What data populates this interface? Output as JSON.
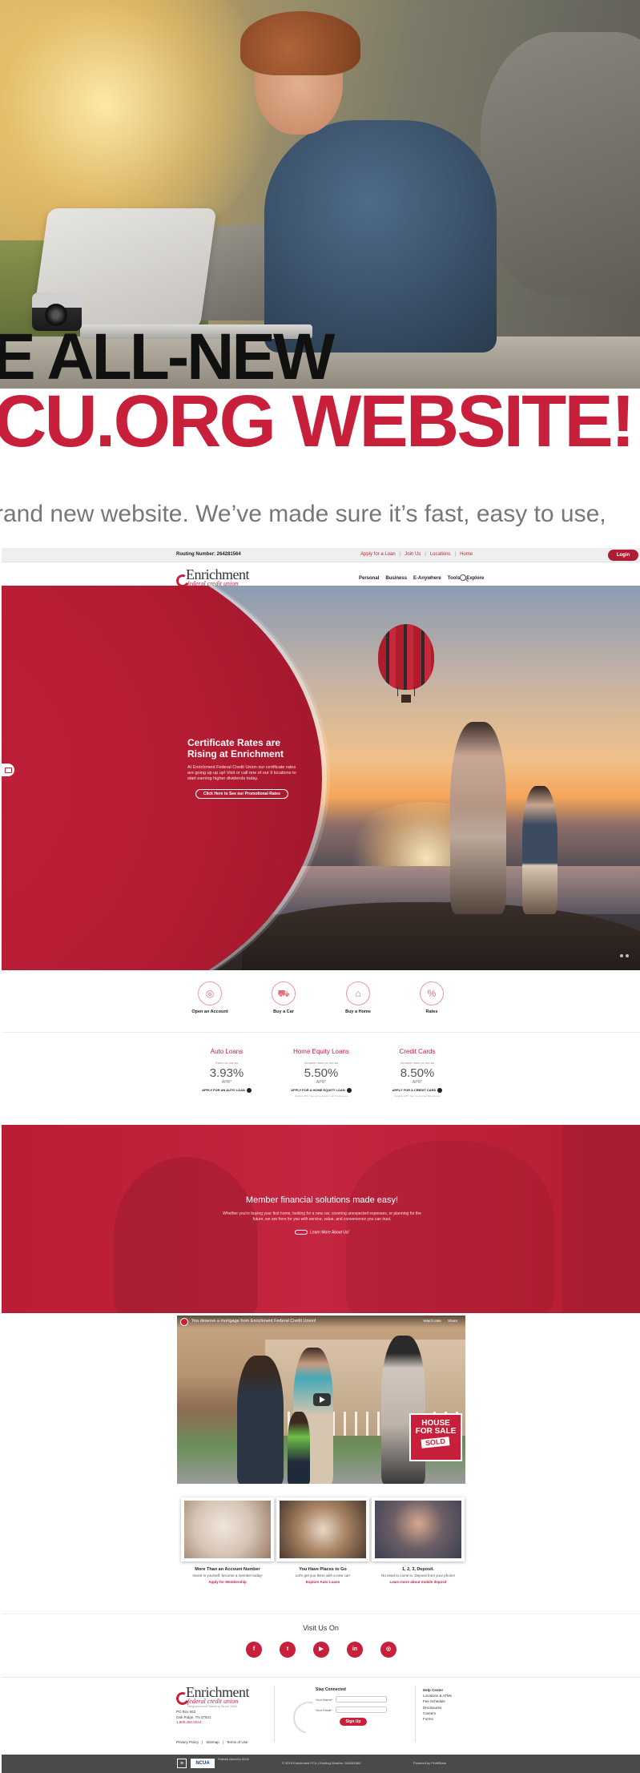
{
  "headline": {
    "line1": "E ALL-NEW",
    "line2": "CU.ORG WEBSITE!",
    "intro": "rand new website. We’ve made sure it’s fast, easy to use,"
  },
  "site": {
    "topbar": {
      "routing": "Routing Number: 264281564",
      "links": [
        "Apply for a Loan",
        "Join Us",
        "Locations",
        "Home"
      ],
      "login": "Login"
    },
    "logo": {
      "name": "Enrichment",
      "sub": "federal credit union",
      "tagline": "Neighborhood Banking Since 1966"
    },
    "nav": [
      "Personal",
      "Business",
      "E-Anywhere",
      "Tools",
      "Explore"
    ],
    "banner": {
      "title": "Certificate Rates are Rising at Enrichment",
      "body": "At Enrichment Federal Credit Union our certificate rates are going up up up! Visit or call one of our 9 locations to start earning higher dividends today.",
      "button": "Click Here to See our Promotional Rates"
    },
    "quicklinks": [
      {
        "label": "Open an Account",
        "icon": "piggy-bank-icon",
        "glyph": "◎"
      },
      {
        "label": "Buy a Car",
        "icon": "car-icon",
        "glyph": "⛟"
      },
      {
        "label": "Buy a Home",
        "icon": "home-icon",
        "glyph": "⌂"
      },
      {
        "label": "Rates",
        "icon": "percent-icon",
        "glyph": "%"
      }
    ],
    "rates": [
      {
        "title": "Auto Loans",
        "small": "Rates as low as",
        "value": "3.93%",
        "apr": "APR*",
        "link": "APPLY FOR AN AUTO LOAN",
        "note": ""
      },
      {
        "title": "Home Equity Loans",
        "small": "Variable rates as low as",
        "value": "5.50%",
        "apr": "APR*",
        "link": "APPLY FOR A HOME EQUITY LOAN",
        "note": "Variable APR. See Home Equity Loan Disclosures"
      },
      {
        "title": "Credit Cards",
        "small": "Variable rates as low as",
        "value": "8.50%",
        "apr": "APR*",
        "link": "APPLY FOR A CREDIT CARD",
        "note": "Variable APR. See Credit Card Disclosures"
      }
    ],
    "solutions": {
      "title": "Member financial solutions made easy!",
      "body": "Whether you're buying your first home, looking for a new car, covering unexpected expenses, or planning for the future, we are here for you with service, value, and convenience you can trust.",
      "button": "Learn More About Us!"
    },
    "video": {
      "title": "You deserve a mortgage from Enrichment Federal Credit Union!",
      "watch_later": "Watch later",
      "share": "Share",
      "sign_line1": "HOUSE",
      "sign_line2": "FOR SALE",
      "sign_sold": "SOLD"
    },
    "cards": [
      {
        "title": "More Than an Account Number",
        "text": "Invest in yourself: become a member today!",
        "link": "Apply for Membership"
      },
      {
        "title": "You Have Places to Go",
        "text": "Let's get you there with a new car!",
        "link": "Explore Auto Loans"
      },
      {
        "title": "1, 2, 3, Deposit.",
        "text": "No need to come in. Deposit from your phone!",
        "link": "Learn more about mobile deposit"
      }
    ],
    "social": {
      "title": "Visit Us On",
      "icons": [
        {
          "name": "facebook-icon",
          "glyph": "f"
        },
        {
          "name": "twitter-icon",
          "glyph": "t"
        },
        {
          "name": "youtube-icon",
          "glyph": "▶"
        },
        {
          "name": "linkedin-icon",
          "glyph": "in"
        },
        {
          "name": "instagram-icon",
          "glyph": "◎"
        }
      ]
    },
    "footer": {
      "address1": "PO Box 663",
      "address2": "Oak Ridge, TN 37831",
      "phone": "1.800.482.6044",
      "links": [
        "Privacy Policy",
        "Sitemap",
        "Terms of Use"
      ],
      "stay_title": "Stay Connected",
      "name_label": "Your Name*",
      "email_label": "Your Email*",
      "signup": "Sign Up",
      "help_title": "Help Center",
      "help_links": [
        "Locations & ATMs",
        "Fee Schedule",
        "Disclosures",
        "Careers",
        "Forms"
      ]
    },
    "bottombar": {
      "housing": "≡",
      "ncua": "NCUA",
      "ncua_text": "Federally Insured by NCUA",
      "copyright": "© 2019 Enrichment FCU | Routing Number: 264281564",
      "credit": "Powered by ProfitStars"
    }
  },
  "colors": {
    "brand_red": "#c8203a",
    "dark_red": "#b01c33",
    "text_dark": "#222222"
  }
}
